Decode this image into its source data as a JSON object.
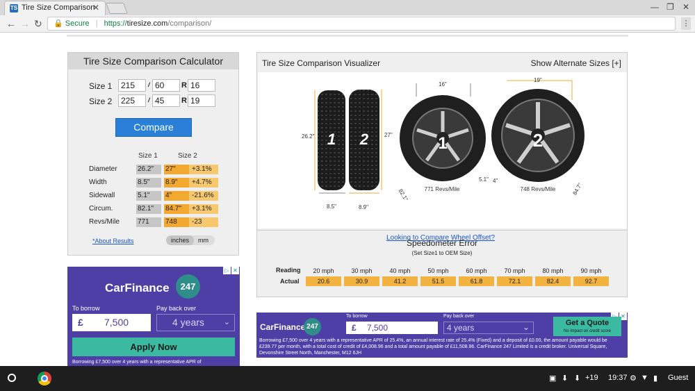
{
  "browser": {
    "tab_title": "Tire Size Comparison",
    "tab_favicon": "TS",
    "secure_label": "Secure",
    "url_scheme": "https://",
    "url_host": "tiresize.com",
    "url_path": "/comparison/"
  },
  "calculator": {
    "title": "Tire Size Comparison Calculator",
    "size1_label": "Size 1",
    "size2_label": "Size 2",
    "size1": {
      "width": "215",
      "aspect": "60",
      "rim": "16"
    },
    "size2": {
      "width": "225",
      "aspect": "45",
      "rim": "19"
    },
    "slash": "/",
    "rim_letter": "R",
    "compare_button": "Compare",
    "col_size1": "Size 1",
    "col_size2": "Size 2",
    "rows": [
      {
        "label": "Diameter",
        "s1": "26.2\"",
        "s2": "27\"",
        "diff": "+3.1%"
      },
      {
        "label": "Width",
        "s1": "8.5\"",
        "s2": "8.9\"",
        "diff": "+4.7%"
      },
      {
        "label": "Sidewall",
        "s1": "5.1\"",
        "s2": "4\"",
        "diff": "-21.6%"
      },
      {
        "label": "Circum.",
        "s1": "82.1\"",
        "s2": "84.7\"",
        "diff": "+3.1%"
      },
      {
        "label": "Revs/Mile",
        "s1": "771",
        "s2": "748",
        "diff": "-23"
      }
    ],
    "about_link": "*About Results",
    "unit_inches": "inches",
    "unit_mm": "mm"
  },
  "visualizer": {
    "title": "Tire Size Comparison Visualizer",
    "alt_sizes": "Show Alternate Sizes [+]",
    "tire1_num": "1",
    "tire2_num": "2",
    "dim_diameter1": "26.2\"",
    "dim_diameter2": "27\"",
    "dim_width1": "8.5\"",
    "dim_width2": "8.9\"",
    "wheel1_rim": "16\"",
    "wheel2_rim": "19\"",
    "wheel1_circ": "82.1\"",
    "wheel2_circ": "84.7\"",
    "wheel1_side": "5.1\"",
    "wheel2_side": "4\"",
    "wheel1_revs": "771 Revs/Mile",
    "wheel2_revs": "748 Revs/Mile",
    "offset_link": "Looking to Compare Wheel Offset?",
    "speedo_title": "Speedometer Error",
    "speedo_sub": "(Set Size1 to OEM Size)",
    "reading_label": "Reading",
    "actual_label": "Actual",
    "readings": [
      "20 mph",
      "30 mph",
      "40 mph",
      "50 mph",
      "60 mph",
      "70 mph",
      "80 mph",
      "90 mph"
    ],
    "actuals": [
      "20.6",
      "30.9",
      "41.2",
      "51.5",
      "61.8",
      "72.1",
      "82.4",
      "92.7"
    ]
  },
  "ad_left": {
    "logo": "CarFinance",
    "logo_num": "247",
    "borrow_label": "To borrow",
    "payback_label": "Pay back over",
    "currency": "£",
    "amount": "7,500",
    "term": "4 years",
    "apply": "Apply Now",
    "fine": "Borrowing £7,500 over 4 years with a representative APR of"
  },
  "ad_bottom": {
    "logo": "CarFinance",
    "logo_num": "247",
    "borrow_label": "To borrow",
    "payback_label": "Pay back over",
    "currency": "£",
    "amount": "7,500",
    "term": "4 years",
    "quote": "Get a Quote",
    "quote_sub": "No impact on credit score",
    "fine": "Borrowing £7,500 over 4 years with a representative APR of 25.4%, an annual interest rate of 25.4% (Fixed) and a deposit of £0.00, the amount payable would be £239.77 per month, with a total cost of credit of £4,008.96 and a total amount payable of £11,508.96. CarFinance 247 Limited is a credit broker. Universal Square, Devonshire Street North, Manchester, M12 6JH"
  },
  "shelf": {
    "notif_count": "+19",
    "time": "19:37",
    "user": "Guest"
  },
  "colors": {
    "accent": "#2a7fd6",
    "size2_highlight": "#f3a82f",
    "ad_purple": "#4d3fa6",
    "ad_teal": "#3bb9a1"
  }
}
